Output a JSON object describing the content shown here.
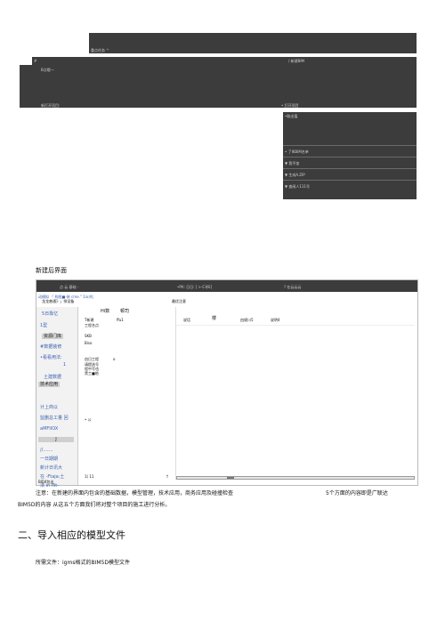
{
  "top_screenshot": {
    "bar1_label": "重点任务 ^",
    "bar2_left": "#",
    "bar2_right": "/ 新建BIM",
    "panel_label1": "B点哦一",
    "panel_label2": "新打开项目:",
    "panel_right_label": "• 打开项目",
    "menu_header": "•取出值",
    "menu_items": [
      "• 了IKBIM名单",
      "▼ 我平加",
      "▼ 生成A.ZIP",
      "▼ 查阅人111号"
    ]
  },
  "caption_new": "新建后界面",
  "screenshot": {
    "title_left": "点  云 基础 -",
    "title_mid": "•Ptl: 日日: [ >-C寻E]",
    "title_right": "? 在云云云",
    "menu_line1": "动模拟 「 构图■-装 cme.\" 1ia:的;",
    "menu_line2": "龙龙普通]- 」排设备   ",
    "menu_line_right": "最优注意",
    "sidebar": {
      "header": "5日靠亿",
      "items": [
        "1型",
        "资源门库",
        "#数据装修",
        "•看看用法:",
        "1",
        "土建数据",
        "技术应用",
        "计上商以",
        "监删总工量  回",
        "aMFIIOX",
        "J",
        "//.......",
        "一日期期",
        "新计日讯大",
        "在 -Ftaja:土",
        "法 in flit-"
      ]
    },
    "mid": {
      "col1_head": "Hi数",
      "col2_head": "顿司",
      "rows": [
        "T新建",
        "工程名点",
        "SKB",
        "Biso",
        "由日工程",
        "请提选号",
        "程中写也",
        "黑工■地",
        "• 公"
      ],
      "right_val": "ffu1",
      "small_val": "o"
    },
    "right": {
      "col1": "说话",
      "col2": "楼",
      "col3": "由规川5",
      "col4": "说明4"
    },
    "bottom_left": "1(      11",
    "bottom_right": "†",
    "status": "BID4包出"
  },
  "note_text": "注意：在新建的界面内包含的基础数据，模型管理，技术应用，商务应用及碰撞检查",
  "note_right": "5个方面的内容即是广联达",
  "note_line2": "BIM5D的内容 从这五个方面我们将对整个项目的施工进行分析。",
  "section_heading": "二、导入相应的模型文件",
  "required_file": "所需文件：igms格式的BIM5D模型文件"
}
